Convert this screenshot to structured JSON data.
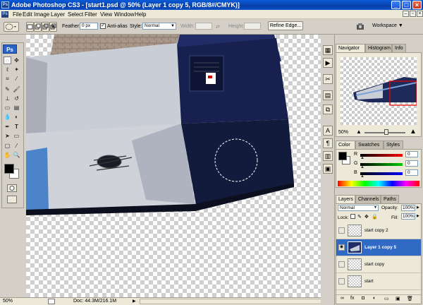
{
  "window": {
    "title": "Adobe Photoshop CS3 - [start1.psd @ 50% (Layer 1 copy 5, RGB/8#/CMYK)]",
    "minimize": "_",
    "maximize": "□",
    "close": "×",
    "app_icon": "Ps"
  },
  "menu": [
    "File",
    "Edit",
    "Image",
    "Layer",
    "Select",
    "Filter",
    "View",
    "Window",
    "Help"
  ],
  "options": {
    "feather_label": "Feather:",
    "feather_value": "0 px",
    "antialias_label": "Anti-alias",
    "style_label": "Style:",
    "style_value": "Normal",
    "width_label": "Width:",
    "height_label": "Height:",
    "refine_edge": "Refine Edge...",
    "workspace": "Workspace ▼"
  },
  "toolbox": {
    "logo": "Ps"
  },
  "status": {
    "zoom": "50%",
    "doc": "Doc: 44.3M/216.1M"
  },
  "navigator": {
    "tabs": [
      "Navigator",
      "Histogram",
      "Info"
    ],
    "zoom": "50%"
  },
  "color_panel": {
    "tabs": [
      "Color",
      "Swatches",
      "Styles"
    ],
    "channels": [
      {
        "label": "R",
        "value": "0",
        "color": "#d00000"
      },
      {
        "label": "G",
        "value": "0",
        "color": "#00a000"
      },
      {
        "label": "B",
        "value": "0",
        "color": "#0000d0"
      }
    ]
  },
  "layers_panel": {
    "tabs": [
      "Layers",
      "Channels",
      "Paths"
    ],
    "blend_mode": "Normal",
    "opacity_label": "Opacity:",
    "opacity": "100%",
    "lock_label": "Lock:",
    "fill_label": "Fill:",
    "fill": "100%",
    "layers": [
      {
        "name": "start copy 2",
        "visible": false,
        "selected": false
      },
      {
        "name": "Layer 1 copy 5",
        "visible": true,
        "selected": true
      },
      {
        "name": "start copy",
        "visible": false,
        "selected": false
      },
      {
        "name": "start",
        "visible": false,
        "selected": false
      }
    ]
  }
}
